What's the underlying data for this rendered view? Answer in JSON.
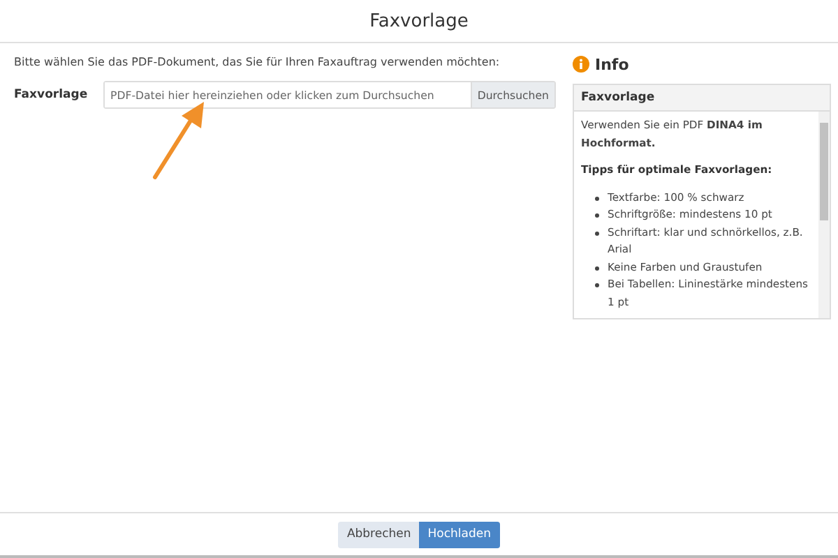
{
  "window": {
    "title": "Faxvorlage"
  },
  "instruction": "Bitte wählen Sie das PDF-Dokument, das Sie für Ihren Faxauftrag verwenden möchten:",
  "file_field": {
    "label": "Faxvorlage",
    "placeholder": "PDF-Datei hier hereinziehen oder klicken zum Durchsuchen",
    "button": "Durchsuchen"
  },
  "info": {
    "title": "Info",
    "panel_title": "Faxvorlage",
    "intro": "Verwenden Sie ein PDF **DINA4 im Hochformat.**",
    "tips_title": "Tipps für optimale Faxvorlagen:",
    "tips": [
      "Textfarbe: 100 % schwarz",
      "Schriftgröße: mindestens 10 pt",
      "Schriftart: klar und schnörkellos, z.B. Arial",
      "Keine Farben und Graustufen",
      "Bei Tabellen: Lininestärke mindestens 1 pt"
    ]
  },
  "buttons": [
    {
      "label": "Abbrechen",
      "kind": "secondary"
    },
    {
      "label": "Hochladen",
      "kind": "primary"
    }
  ]
}
